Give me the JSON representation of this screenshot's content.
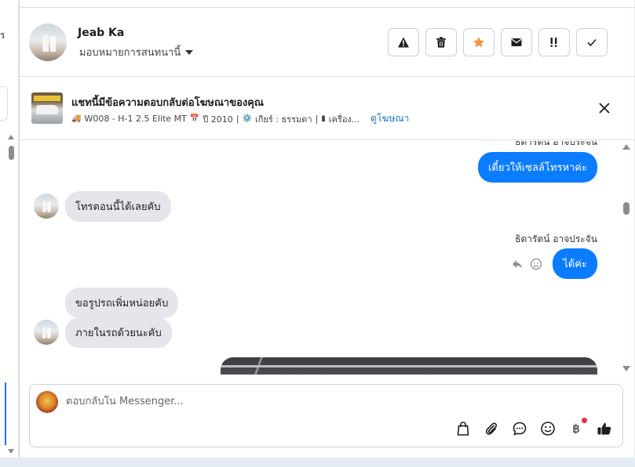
{
  "left_panel": {
    "cut_text": "ร"
  },
  "header": {
    "contact_name": "Jeab Ka",
    "assign_label": "มอบหมายการสนทนานี้",
    "actions": [
      {
        "name": "report-button",
        "icon": "warning-icon"
      },
      {
        "name": "delete-button",
        "icon": "trash-icon"
      },
      {
        "name": "star-button",
        "icon": "star-icon"
      },
      {
        "name": "mark-unread-button",
        "icon": "mail-icon"
      },
      {
        "name": "spam-button",
        "icon": "spam-icon"
      },
      {
        "name": "done-button",
        "icon": "check-icon"
      }
    ],
    "star_color": "#f5923e"
  },
  "ad": {
    "title": "แชทนี้มีข้อความตอบกลับต่อโฆษณาของคุณ",
    "truck_icon": "🚚",
    "model": "W008 - H-1 2.5 Elite MT",
    "calendar_icon": "📅",
    "year": "ปี 2010",
    "gear_icon": "⚙️",
    "gear": "เกียร์ : ธรรมดา",
    "engine_icon": "▮",
    "engine": "เครื่อง...",
    "separator": "|",
    "link": "ดูโฆษณา"
  },
  "messages": {
    "top_sender_partial": "ธิดารัตน์ อาจประจัน",
    "out_1": "เดี๋ยวให้เซลล์โทรหาค่ะ",
    "in_1": "โทรตอนนี้ได้เลยคับ",
    "sender_2": "ธิดารัตน์ อาจประจัน",
    "out_2": "ได้ค่ะ",
    "in_2": "ขอรูปรถเพิ่มหน่อยคับ",
    "in_3": "ภายในรถด้วยนะคับ"
  },
  "composer": {
    "placeholder": "ตอบกลับใน Messenger...",
    "baht_symbol": "฿",
    "accent": "#0a7cff"
  }
}
